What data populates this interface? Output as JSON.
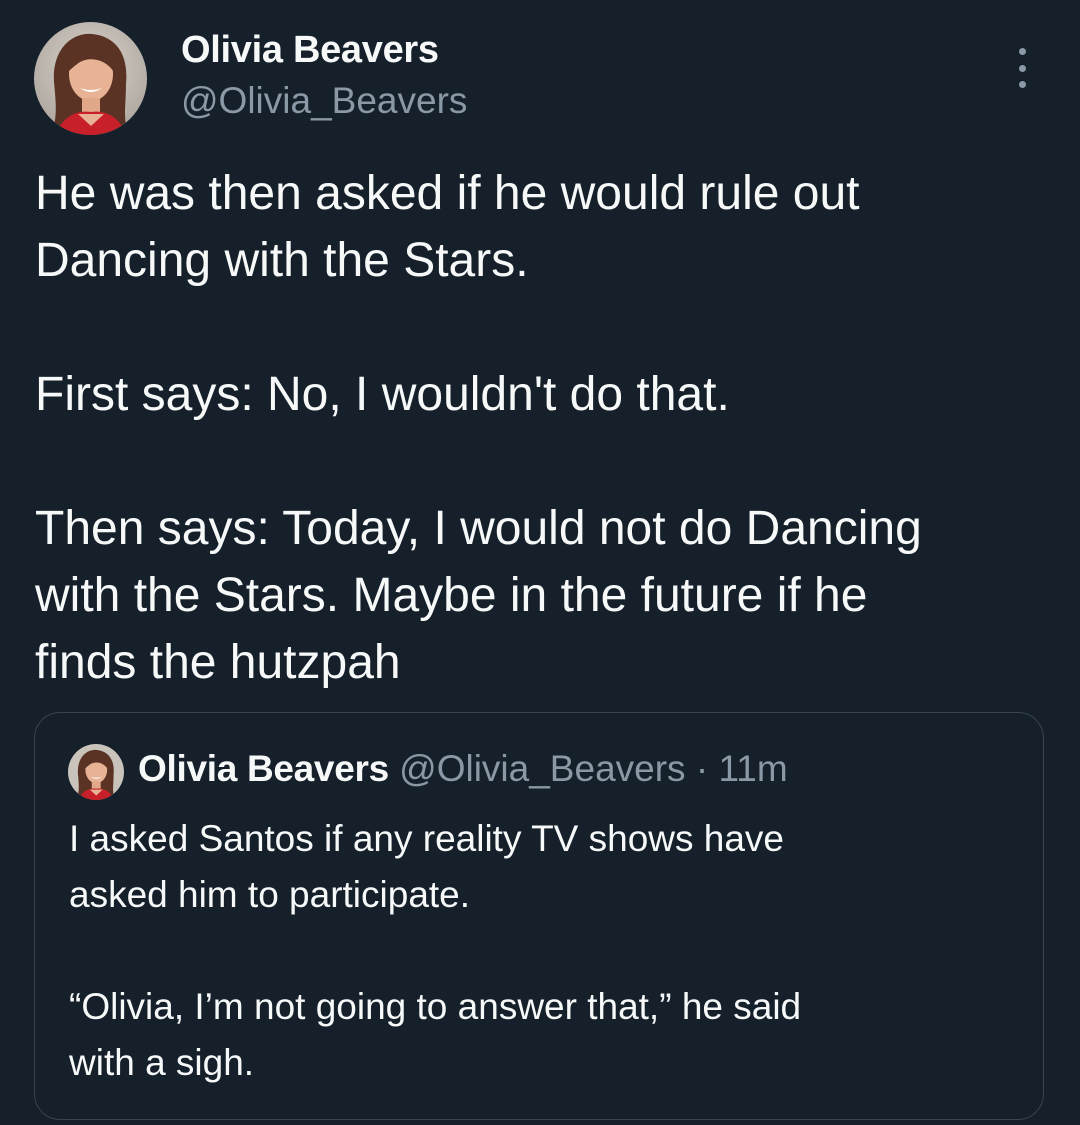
{
  "author": {
    "name": "Olivia Beavers",
    "handle": "@Olivia_Beavers"
  },
  "menu": {
    "icon": "more-vertical-icon"
  },
  "tweet": {
    "lines": [
      "He was then asked if he would rule out",
      "Dancing with the Stars.",
      "",
      "First says: No, I wouldn't do that.",
      "",
      "Then says: Today, I would not do Dancing",
      "with the Stars. Maybe in the future if he",
      "finds the hutzpah"
    ]
  },
  "quoted_tweet": {
    "name": "Olivia Beavers",
    "handle": "@Olivia_Beavers",
    "separator": "·",
    "time": "11m",
    "lines": [
      "I asked Santos if any reality TV shows have",
      "asked him to participate.",
      "",
      "“Olivia, I’m not going to answer that,” he said",
      "with a sigh."
    ]
  },
  "colors": {
    "background": "#15202b",
    "primary_text": "#f7f9f9",
    "secondary_text": "#8b98a5",
    "border": "#38444d"
  }
}
